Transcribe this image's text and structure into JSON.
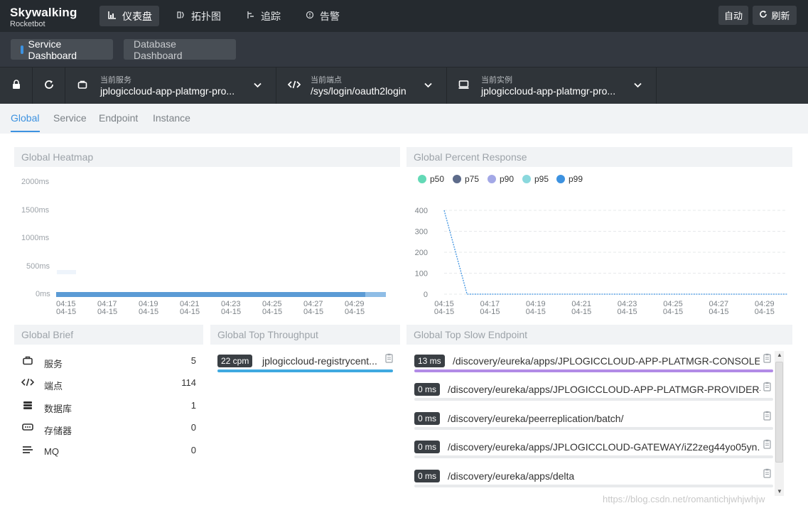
{
  "app": {
    "logo": "Skywalking",
    "subtitle": "Rocketbot"
  },
  "nav": [
    {
      "label": "仪表盘",
      "icon": "chart-icon",
      "active": true
    },
    {
      "label": "拓扑图",
      "icon": "topology-icon",
      "active": false
    },
    {
      "label": "追踪",
      "icon": "trace-icon",
      "active": false
    },
    {
      "label": "告警",
      "icon": "alarm-icon",
      "active": false
    }
  ],
  "top_buttons": {
    "auto": "自动",
    "refresh": "刷新"
  },
  "dashboards": {
    "service": "Service Dashboard",
    "database": "Database Dashboard"
  },
  "selectors": {
    "service": {
      "label": "当前服务",
      "value": "jplogiccloud-app-platmgr-pro..."
    },
    "endpoint": {
      "label": "当前端点",
      "value": "/sys/login/oauth2login"
    },
    "instance": {
      "label": "当前实例",
      "value": "jplogiccloud-app-platmgr-pro..."
    }
  },
  "tabs": [
    "Global",
    "Service",
    "Endpoint",
    "Instance"
  ],
  "panels": {
    "heatmap": "Global Heatmap",
    "percent": "Global Percent Response",
    "brief": "Global Brief",
    "throughput": "Global Top Throughput",
    "slow": "Global Top Slow Endpoint"
  },
  "heatmap": {
    "y_ticks": [
      "2000ms",
      "1500ms",
      "1000ms",
      "500ms",
      "0ms"
    ],
    "x_ticks": [
      "04:15",
      "04:17",
      "04:19",
      "04:21",
      "04:23",
      "04:25",
      "04:27",
      "04:29"
    ],
    "x_date": "04-15",
    "color": "#5b9bd5"
  },
  "chart_data": {
    "type": "line",
    "x": [
      "04:15",
      "04:16",
      "04:17",
      "04:18",
      "04:19",
      "04:20",
      "04:21",
      "04:22",
      "04:23",
      "04:24",
      "04:25",
      "04:26",
      "04:27",
      "04:28",
      "04:29",
      "04:30"
    ],
    "x_tick_labels": [
      "04:15",
      "04:17",
      "04:19",
      "04:21",
      "04:23",
      "04:25",
      "04:27",
      "04:29"
    ],
    "x_date": "04-15",
    "y_ticks": [
      400,
      300,
      200,
      100,
      0
    ],
    "ylim": [
      0,
      400
    ],
    "legend": [
      {
        "name": "p50",
        "color": "#63d9b6"
      },
      {
        "name": "p75",
        "color": "#5d6b8a"
      },
      {
        "name": "p90",
        "color": "#a3a8e6"
      },
      {
        "name": "p95",
        "color": "#8ad8dd"
      },
      {
        "name": "p99",
        "color": "#3d92e0"
      }
    ],
    "series": [
      {
        "name": "p99",
        "values": [
          400,
          0,
          0,
          0,
          0,
          0,
          0,
          0,
          0,
          0,
          0,
          0,
          0,
          0,
          0,
          0
        ]
      }
    ],
    "grid": true
  },
  "brief": [
    {
      "icon": "service-icon",
      "label": "服务",
      "value": "5"
    },
    {
      "icon": "endpoint-icon",
      "label": "端点",
      "value": "114"
    },
    {
      "icon": "database-icon",
      "label": "数据库",
      "value": "1"
    },
    {
      "icon": "cache-icon",
      "label": "存储器",
      "value": "0"
    },
    {
      "icon": "mq-icon",
      "label": "MQ",
      "value": "0"
    }
  ],
  "throughput": [
    {
      "value": "22 cpm",
      "name": "jplogiccloud-registrycent...",
      "fraction": 1.0
    }
  ],
  "slow": [
    {
      "value": "13 ms",
      "name": "/discovery/eureka/apps/JPLOGICCLOUD-APP-PLATMGR-CONSOLE-...",
      "fraction": 1.0,
      "color": "#b28be6"
    },
    {
      "value": "0 ms",
      "name": "/discovery/eureka/apps/JPLOGICCLOUD-APP-PLATMGR-PROVIDER-...",
      "fraction": 0.0,
      "color": "#b28be6"
    },
    {
      "value": "0 ms",
      "name": "/discovery/eureka/peerreplication/batch/",
      "fraction": 0.0,
      "color": "#b28be6"
    },
    {
      "value": "0 ms",
      "name": "/discovery/eureka/apps/JPLOGICCLOUD-GATEWAY/iZ2zeg44yo05yn...",
      "fraction": 0.0,
      "color": "#b28be6"
    },
    {
      "value": "0 ms",
      "name": "/discovery/eureka/apps/delta",
      "fraction": 0.0,
      "color": "#b28be6"
    }
  ],
  "watermark": "https://blog.csdn.net/romantichjwhjwhjw"
}
